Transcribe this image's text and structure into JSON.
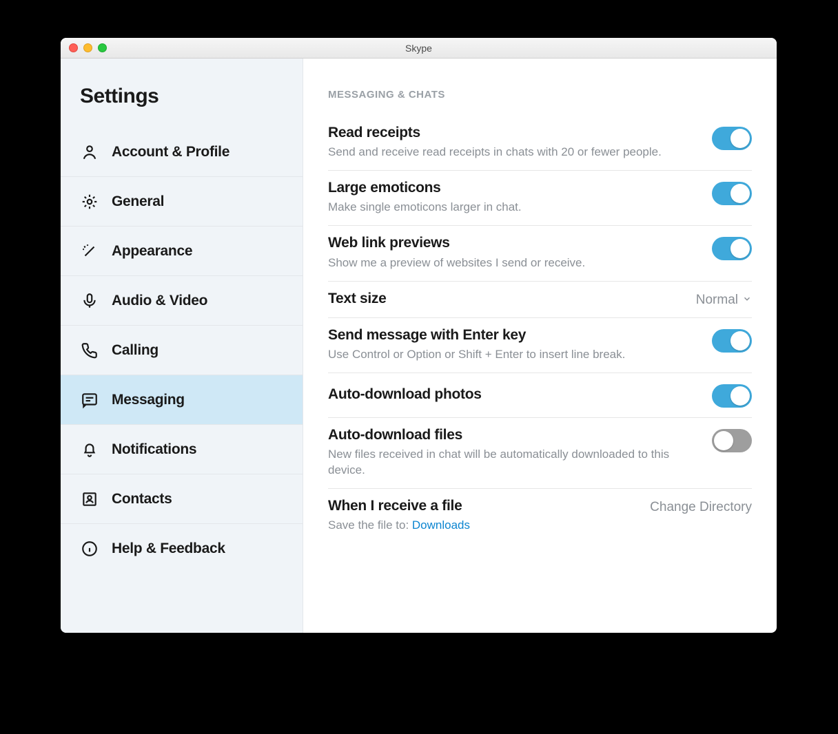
{
  "window": {
    "title": "Skype"
  },
  "sidebar": {
    "title": "Settings",
    "items": [
      {
        "id": "account",
        "label": "Account & Profile",
        "icon": "person-icon"
      },
      {
        "id": "general",
        "label": "General",
        "icon": "gear-icon"
      },
      {
        "id": "appearance",
        "label": "Appearance",
        "icon": "wand-icon"
      },
      {
        "id": "audio-video",
        "label": "Audio & Video",
        "icon": "mic-icon"
      },
      {
        "id": "calling",
        "label": "Calling",
        "icon": "phone-icon"
      },
      {
        "id": "messaging",
        "label": "Messaging",
        "icon": "chat-icon",
        "active": true
      },
      {
        "id": "notifications",
        "label": "Notifications",
        "icon": "bell-icon"
      },
      {
        "id": "contacts",
        "label": "Contacts",
        "icon": "contacts-icon"
      },
      {
        "id": "help",
        "label": "Help & Feedback",
        "icon": "info-icon"
      }
    ]
  },
  "content": {
    "section_heading": "MESSAGING & CHATS",
    "settings": {
      "read_receipts": {
        "title": "Read receipts",
        "desc": "Send and receive read receipts in chats with 20 or fewer people.",
        "value": true
      },
      "large_emoticons": {
        "title": "Large emoticons",
        "desc": "Make single emoticons larger in chat.",
        "value": true
      },
      "web_link_previews": {
        "title": "Web link previews",
        "desc": "Show me a preview of websites I send or receive.",
        "value": true
      },
      "text_size": {
        "title": "Text size",
        "value": "Normal"
      },
      "send_with_enter": {
        "title": "Send message with Enter key",
        "desc": "Use Control or Option or Shift + Enter to insert line break.",
        "value": true
      },
      "auto_download_photos": {
        "title": "Auto-download photos",
        "value": true
      },
      "auto_download_files": {
        "title": "Auto-download files",
        "desc": "New files received in chat will be automatically downloaded to this device.",
        "value": false
      },
      "receive_file": {
        "title": "When I receive a file",
        "desc_prefix": "Save the file to: ",
        "desc_link": "Downloads",
        "button": "Change Directory"
      }
    }
  }
}
